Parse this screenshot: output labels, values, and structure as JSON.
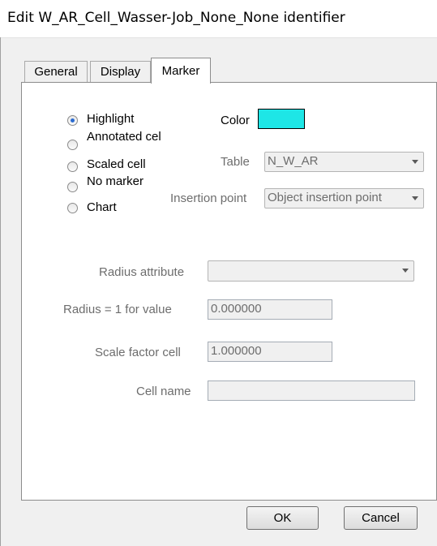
{
  "window": {
    "title": "Edit W_AR_Cell_Wasser-Job_None_None identifier"
  },
  "tabs": [
    {
      "label": "General"
    },
    {
      "label": "Display"
    },
    {
      "label": "Marker"
    }
  ],
  "marker": {
    "options": [
      {
        "label": "Highlight",
        "checked": true
      },
      {
        "label": "Annotated cel",
        "checked": false
      },
      {
        "label": "Scaled cell",
        "checked": false
      },
      {
        "label": "No marker",
        "checked": false
      },
      {
        "label": "Chart",
        "checked": false
      }
    ],
    "color_label": "Color",
    "color_value": "#1ee6e6",
    "table_label": "Table",
    "table_value": "N_W_AR",
    "insertion_label": "Insertion point",
    "insertion_value": "Object insertion point",
    "radius_attribute_label": "Radius attribute",
    "radius_attribute_value": "",
    "radius_value_label": "Radius = 1 for value",
    "radius_value": "0.000000",
    "scale_factor_label": "Scale factor cell",
    "scale_factor_value": "1.000000",
    "cell_name_label": "Cell name",
    "cell_name_value": ""
  },
  "buttons": {
    "ok": "OK",
    "cancel": "Cancel"
  }
}
